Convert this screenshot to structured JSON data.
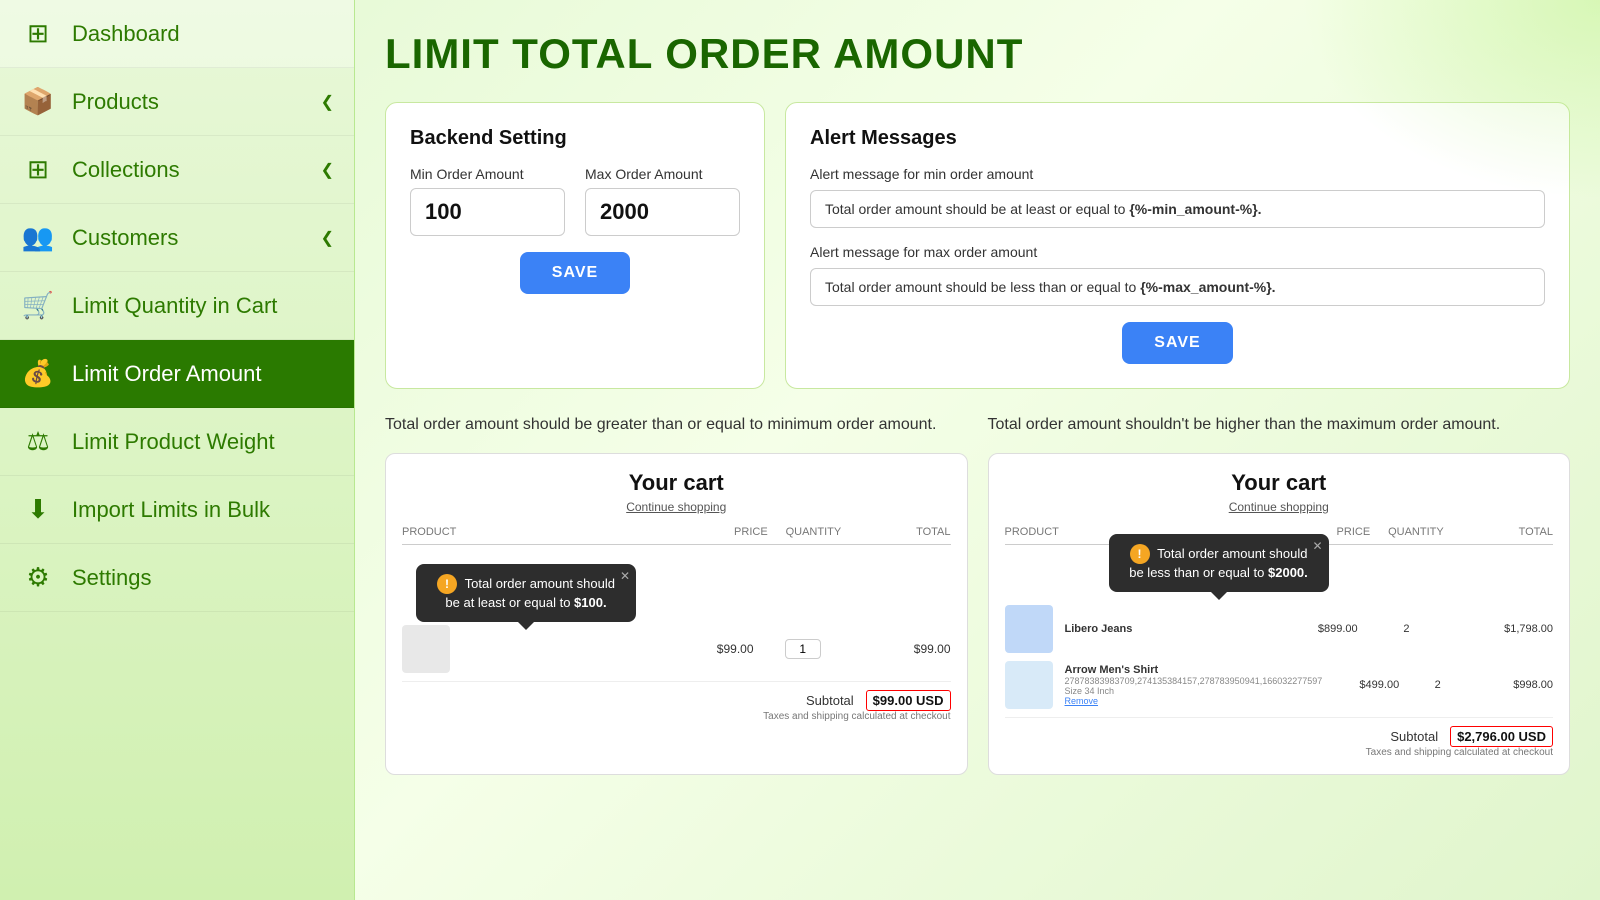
{
  "sidebar": {
    "items": [
      {
        "id": "dashboard",
        "label": "Dashboard",
        "icon": "⊞",
        "active": false,
        "hasChevron": false
      },
      {
        "id": "products",
        "label": "Products",
        "icon": "📦",
        "active": false,
        "hasChevron": true
      },
      {
        "id": "collections",
        "label": "Collections",
        "icon": "⊞",
        "active": false,
        "hasChevron": true
      },
      {
        "id": "customers",
        "label": "Customers",
        "icon": "👥",
        "active": false,
        "hasChevron": true
      },
      {
        "id": "limit-quantity",
        "label": "Limit Quantity in Cart",
        "icon": "🛒",
        "active": false,
        "hasChevron": false
      },
      {
        "id": "limit-order",
        "label": "Limit Order Amount",
        "icon": "💰",
        "active": true,
        "hasChevron": false
      },
      {
        "id": "limit-weight",
        "label": "Limit Product Weight",
        "icon": "⚖",
        "active": false,
        "hasChevron": false
      },
      {
        "id": "import-limits",
        "label": "Import Limits in Bulk",
        "icon": "⬇",
        "active": false,
        "hasChevron": false
      },
      {
        "id": "settings",
        "label": "Settings",
        "icon": "⚙",
        "active": false,
        "hasChevron": false
      }
    ]
  },
  "page": {
    "title": "LIMIT TOTAL ORDER AMOUNT"
  },
  "backend": {
    "title": "Backend Setting",
    "min_label": "Min Order Amount",
    "max_label": "Max Order Amount",
    "min_value": "100",
    "max_value": "2000",
    "save_label": "SAVE"
  },
  "alerts": {
    "title": "Alert Messages",
    "min_label": "Alert message for min order amount",
    "min_value": "Total order amount should be at least or equal to {%-min_amount-%}.",
    "max_label": "Alert message for max order amount",
    "max_value": "Total order amount should be less than or equal to {%-max_amount-%}.",
    "save_label": "SAVE"
  },
  "descriptions": {
    "left": "Total order amount should be greater than or equal to minimum order amount.",
    "right": "Total order amount shouldn't be higher than the maximum order amount."
  },
  "preview_left": {
    "title": "Your cart",
    "link": "Continue shopping",
    "headers": [
      "PRODUCT",
      "PRICE",
      "QUANTITY",
      "TOTAL"
    ],
    "product_price": "$99.00",
    "product_qty": "1",
    "product_total": "$99.00",
    "subtotal_label": "Subtotal",
    "subtotal_value": "$99.00 USD",
    "taxes_note": "Taxes and shipping calculated at checkout",
    "tooltip": "Total order amount should be at least or equal to $100.",
    "tooltip_amount": "$100."
  },
  "preview_right": {
    "title": "Your cart",
    "link": "Continue shopping",
    "headers": [
      "PRODUCT",
      "PRICE",
      "QUANTITY",
      "TOTAL"
    ],
    "product1": {
      "name": "Libero Jeans",
      "price": "$899.00",
      "qty": "2",
      "total": "$1,798.00"
    },
    "product2": {
      "name": "Arrow Men's Shirt",
      "sku": "27878383983709,274135384157,278783950941,166032277597",
      "size": "Size 34 Inch",
      "price": "$499.00",
      "qty": "2",
      "total": "$998.00"
    },
    "subtotal_label": "Subtotal",
    "subtotal_value": "$2,796.00 USD",
    "taxes_note": "Taxes and shipping calculated at checkout",
    "tooltip": "Total order amount should be less than or equal to $2000.",
    "tooltip_amount": "$2000."
  }
}
